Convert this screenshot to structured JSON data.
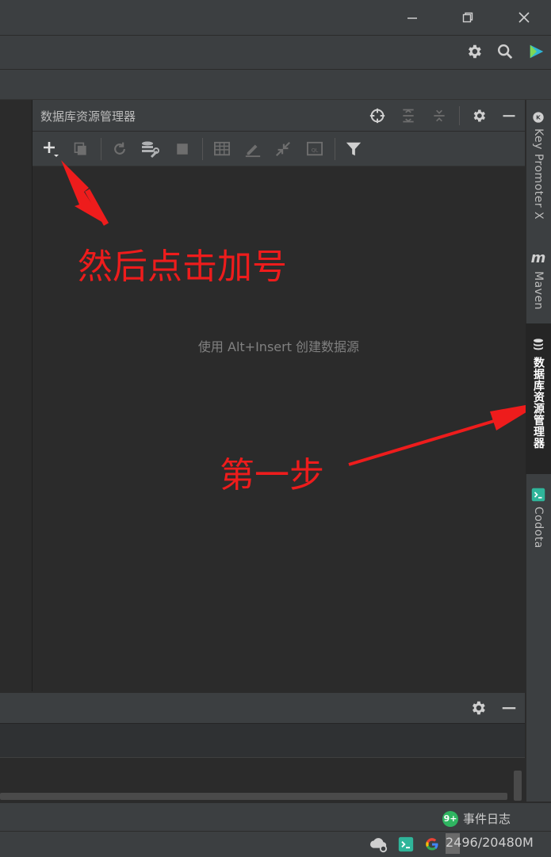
{
  "window": {
    "minimize_icon": "minimize-icon",
    "restore_icon": "restore-icon",
    "close_icon": "close-icon"
  },
  "main_toolbar": {
    "settings_icon": "gear-icon",
    "search_icon": "search-icon",
    "plugin_icon": "codota-plugin-icon"
  },
  "database_panel": {
    "title": "数据库资源管理器",
    "empty_hint": "使用 Alt+Insert 创建数据源",
    "header_icons": [
      "crosshair-icon",
      "expand-all-icon",
      "collapse-all-icon",
      "gear-icon",
      "minimize-icon"
    ],
    "toolbar_icons": [
      "add-icon",
      "copy-icon",
      "refresh-icon",
      "properties-icon",
      "stop-icon",
      "table-icon",
      "edit-icon",
      "jump-icon",
      "console-icon",
      "filter-icon"
    ]
  },
  "right_stripe": {
    "items": [
      {
        "label": "Key Promoter X",
        "icon": "key-promoter-icon"
      },
      {
        "label": "Maven",
        "icon": "maven-icon"
      },
      {
        "label": "数据库资源管理器",
        "icon": "database-icon"
      },
      {
        "label": "Codota",
        "icon": "codota-icon"
      }
    ]
  },
  "annotations": {
    "click_plus": "然后点击加号",
    "step_one": "第一步",
    "color": "#ee1c1c"
  },
  "status_bar": {
    "event_badge": "9+",
    "event_log": "事件日志",
    "memory": "2496/20480M"
  }
}
